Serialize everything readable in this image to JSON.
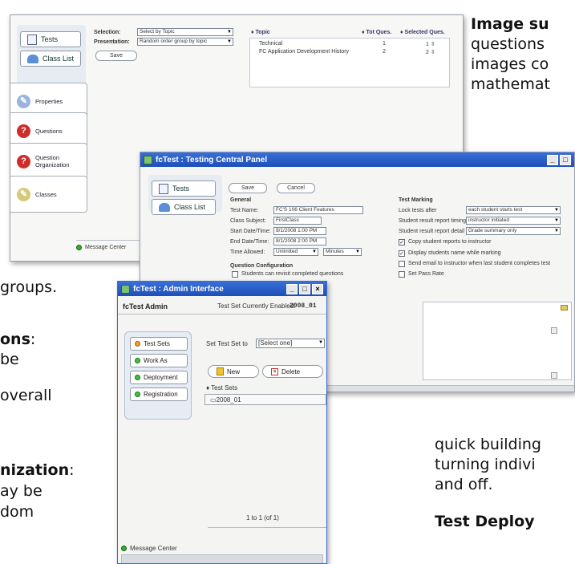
{
  "doc": {
    "tr1": "Image su",
    "tr2": "questions",
    "tr3": "images co",
    "tr4": "mathemat",
    "l1": "groups.",
    "l2b": "ons",
    "l2": ":",
    "l3": "be",
    "l4": "overall",
    "l5b": "nization",
    "l5": ":",
    "l6": "ay be",
    "l7": "dom",
    "br1": "quick building",
    "br2": "turning indivi",
    "br3": "and off.",
    "br4": "Test Deploy"
  },
  "win1": {
    "nav_tests": "Tests",
    "nav_classlist": "Class List",
    "tabs": [
      "Properties",
      "Questions",
      "Question Organization",
      "Classes"
    ],
    "selection_label": "Selection:",
    "selection_value": "Select by Topic",
    "presentation_label": "Presentation:",
    "presentation_value": "Random order group by topic",
    "save": "Save",
    "col_topic": "Topic",
    "col_tot": "Tot Ques.",
    "col_selected": "Selected Ques.",
    "rows": [
      {
        "topic": "Technical",
        "tot": "1",
        "sel": "1"
      },
      {
        "topic": "FC Application Development History",
        "tot": "2",
        "sel": "2"
      }
    ],
    "message_center": "Message Center"
  },
  "win2": {
    "title": "fcTest : Testing Central Panel",
    "nav_tests": "Tests",
    "nav_classlist": "Class List",
    "save": "Save",
    "cancel": "Cancel",
    "general": "General",
    "test_name_label": "Test Name:",
    "test_name_value": "FC'S 106 Client Features",
    "class_subject_label": "Class Subject:",
    "class_subject_value": "FirstClass",
    "start_label": "Start Date/Time:",
    "start_value": "8/1/2008 1:00 PM",
    "end_label": "End Date/Time:",
    "end_value": "8/1/2008 2:00 PM",
    "time_allowed_label": "Time Allowed:",
    "time_allowed_value": "Unlimited",
    "time_unit_value": "Minutes",
    "qconfig": "Question Configuration",
    "revisit": "Students can revisit completed questions",
    "marking": "Test Marking",
    "lock_label": "Lock tests after",
    "lock_value": "each student starts test",
    "report_timing_label": "Student result report timing",
    "report_timing_value": "instructor initiated",
    "report_detail_label": "Student result report detail",
    "report_detail_value": "Grade summary only",
    "copy_reports": "Copy student reports to instructor",
    "display_name": "Display students name while marking",
    "send_email": "Send email to instructor when last student completes test",
    "pass_rate": "Set Pass Rate"
  },
  "win3": {
    "title": "fcTest : Admin Interface",
    "app_name": "fcTest Admin",
    "enabled_label": "Test Set Currently Enabled:",
    "enabled_value": "2008_01",
    "nav": [
      "Test Sets",
      "Work As",
      "Deployment",
      "Registration"
    ],
    "set_label": "Set Test Set to",
    "set_value": "[Select one]",
    "new": "New",
    "delete": "Delete",
    "test_sets_header": "Test Sets",
    "items": [
      "2008_01"
    ],
    "pager": "1 to 1 (of 1)",
    "message_center": "Message Center"
  }
}
